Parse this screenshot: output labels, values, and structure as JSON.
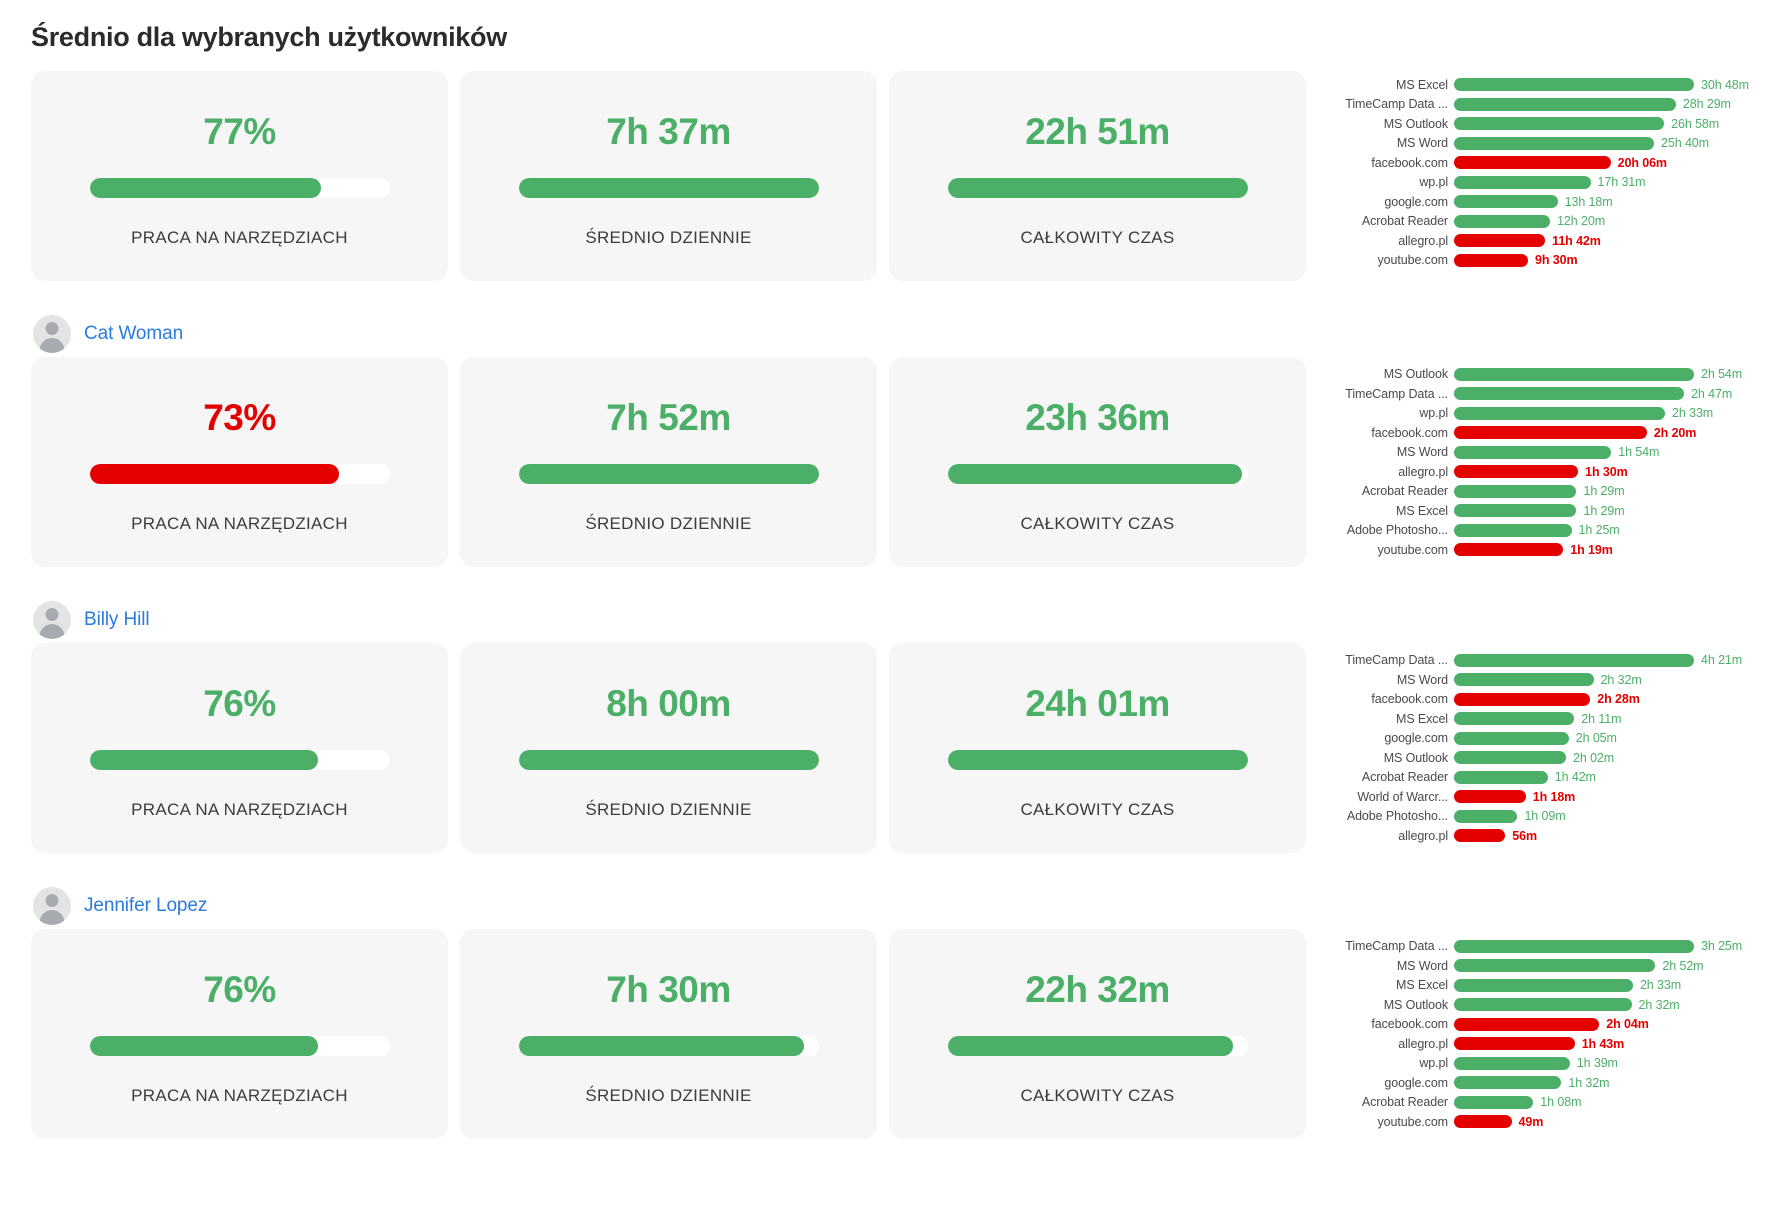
{
  "header": {
    "title": "Średnio dla wybranych użytkowników"
  },
  "colors": {
    "green": "#4caf68",
    "red": "#e50000",
    "link": "#2a7ae2",
    "card_bg": "#f6f6f7",
    "track_bg": "#ffffff"
  },
  "labels": {
    "tool_work": "PRACA NA NARZĘDZIACH",
    "daily_avg": "ŚREDNIO DZIENNIE",
    "total_time": "CAŁKOWITY CZAS"
  },
  "sections": [
    {
      "id": "average",
      "user": null,
      "cards": [
        {
          "value": "77%",
          "color": "green",
          "percent": 77,
          "label": "PRACA NA NARZĘDZIACH"
        },
        {
          "value": "7h 37m",
          "color": "green",
          "percent": 100,
          "label": "ŚREDNIO DZIENNIE"
        },
        {
          "value": "22h 51m",
          "color": "green",
          "percent": 100,
          "label": "CAŁKOWITY CZAS"
        }
      ],
      "chart_data": {
        "type": "bar",
        "title": "Średnio dla wybranych użytkowników",
        "orientation": "horizontal",
        "xlabel": "",
        "ylabel": "",
        "grid": false,
        "legend": false,
        "categories": [
          "MS Excel",
          "TimeCamp Data ...",
          "MS Outlook",
          "MS Word",
          "facebook.com",
          "wp.pl",
          "google.com",
          "Acrobat Reader",
          "allegro.pl",
          "youtube.com"
        ],
        "values": [
          30.8,
          28.48,
          26.97,
          25.67,
          20.1,
          17.52,
          13.3,
          12.33,
          11.7,
          9.5
        ],
        "value_labels": [
          "30h 48m",
          "28h 29m",
          "26h 58m",
          "25h 40m",
          "20h 06m",
          "17h 31m",
          "13h 18m",
          "12h 20m",
          "11h 42m",
          "9h 30m"
        ],
        "colors": [
          "green",
          "green",
          "green",
          "green",
          "red",
          "green",
          "green",
          "green",
          "red",
          "red"
        ]
      }
    },
    {
      "id": "cat-woman",
      "user": {
        "name": "Cat Woman",
        "avatar": "user-avatar-icon"
      },
      "cards": [
        {
          "value": "73%",
          "color": "red",
          "percent": 83,
          "label": "PRACA NA NARZĘDZIACH"
        },
        {
          "value": "7h 52m",
          "color": "green",
          "percent": 100,
          "label": "ŚREDNIO DZIENNIE"
        },
        {
          "value": "23h 36m",
          "color": "green",
          "percent": 98,
          "label": "CAŁKOWITY CZAS"
        }
      ],
      "chart_data": {
        "type": "bar",
        "title": "Cat Woman",
        "orientation": "horizontal",
        "xlabel": "",
        "ylabel": "",
        "grid": false,
        "legend": false,
        "categories": [
          "MS Outlook",
          "TimeCamp Data ...",
          "wp.pl",
          "facebook.com",
          "MS Word",
          "allegro.pl",
          "Acrobat Reader",
          "MS Excel",
          "Adobe Photosho...",
          "youtube.com"
        ],
        "values": [
          2.9,
          2.78,
          2.55,
          2.33,
          1.9,
          1.5,
          1.48,
          1.48,
          1.42,
          1.32
        ],
        "value_labels": [
          "2h 54m",
          "2h 47m",
          "2h 33m",
          "2h 20m",
          "1h 54m",
          "1h 30m",
          "1h 29m",
          "1h 29m",
          "1h 25m",
          "1h 19m"
        ],
        "colors": [
          "green",
          "green",
          "green",
          "red",
          "green",
          "red",
          "green",
          "green",
          "green",
          "red"
        ]
      }
    },
    {
      "id": "billy-hill",
      "user": {
        "name": "Billy Hill",
        "avatar": "user-avatar-icon"
      },
      "cards": [
        {
          "value": "76%",
          "color": "green",
          "percent": 76,
          "label": "PRACA NA NARZĘDZIACH"
        },
        {
          "value": "8h 00m",
          "color": "green",
          "percent": 100,
          "label": "ŚREDNIO DZIENNIE"
        },
        {
          "value": "24h 01m",
          "color": "green",
          "percent": 100,
          "label": "CAŁKOWITY CZAS"
        }
      ],
      "chart_data": {
        "type": "bar",
        "title": "Billy Hill",
        "orientation": "horizontal",
        "xlabel": "",
        "ylabel": "",
        "grid": false,
        "legend": false,
        "categories": [
          "TimeCamp Data ...",
          "MS Word",
          "facebook.com",
          "MS Excel",
          "google.com",
          "MS Outlook",
          "Acrobat Reader",
          "World of Warcr...",
          "Adobe Photosho...",
          "allegro.pl"
        ],
        "values": [
          4.35,
          2.53,
          2.47,
          2.18,
          2.08,
          2.03,
          1.7,
          1.3,
          1.15,
          0.93
        ],
        "value_labels": [
          "4h 21m",
          "2h 32m",
          "2h 28m",
          "2h 11m",
          "2h 05m",
          "2h 02m",
          "1h 42m",
          "1h 18m",
          "1h 09m",
          "56m"
        ],
        "colors": [
          "green",
          "green",
          "red",
          "green",
          "green",
          "green",
          "green",
          "red",
          "green",
          "red"
        ]
      }
    },
    {
      "id": "jennifer-lopez",
      "user": {
        "name": "Jennifer Lopez",
        "avatar": "user-avatar-icon"
      },
      "cards": [
        {
          "value": "76%",
          "color": "green",
          "percent": 76,
          "label": "PRACA NA NARZĘDZIACH"
        },
        {
          "value": "7h 30m",
          "color": "green",
          "percent": 95,
          "label": "ŚREDNIO DZIENNIE"
        },
        {
          "value": "22h 32m",
          "color": "green",
          "percent": 95,
          "label": "CAŁKOWITY CZAS"
        }
      ],
      "chart_data": {
        "type": "bar",
        "title": "Jennifer Lopez",
        "orientation": "horizontal",
        "xlabel": "",
        "ylabel": "",
        "grid": false,
        "legend": false,
        "categories": [
          "TimeCamp Data ...",
          "MS Word",
          "MS Excel",
          "MS Outlook",
          "facebook.com",
          "allegro.pl",
          "wp.pl",
          "google.com",
          "Acrobat Reader",
          "youtube.com"
        ],
        "values": [
          3.42,
          2.87,
          2.55,
          2.53,
          2.07,
          1.72,
          1.65,
          1.53,
          1.13,
          0.82
        ],
        "value_labels": [
          "3h 25m",
          "2h 52m",
          "2h 33m",
          "2h 32m",
          "2h 04m",
          "1h 43m",
          "1h 39m",
          "1h 32m",
          "1h 08m",
          "49m"
        ],
        "colors": [
          "green",
          "green",
          "green",
          "green",
          "red",
          "red",
          "green",
          "green",
          "green",
          "red"
        ]
      }
    }
  ]
}
